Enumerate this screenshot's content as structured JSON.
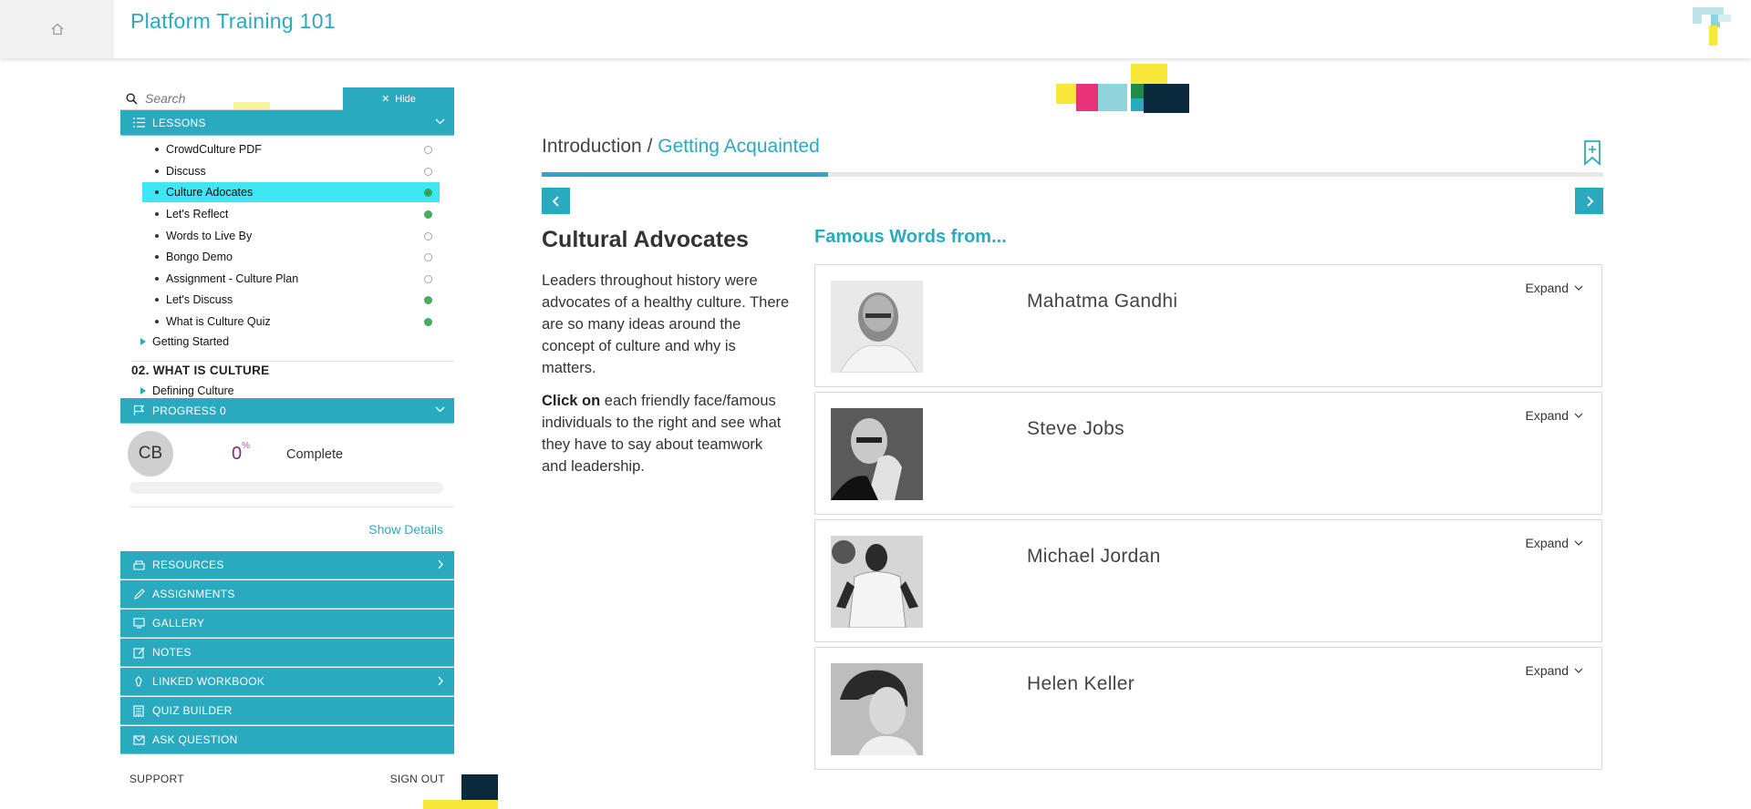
{
  "app": {
    "title": "Platform Training 101"
  },
  "sidebar": {
    "search_placeholder": "Search",
    "hide_label": "Hide",
    "lessons_header": "LESSONS",
    "lessons": [
      {
        "label": "CrowdCulture PDF",
        "status": "empty"
      },
      {
        "label": "Discuss",
        "status": "empty"
      },
      {
        "label": "Culture Adocates",
        "status": "active"
      },
      {
        "label": "Let's Reflect",
        "status": "done"
      },
      {
        "label": "Words to Live By",
        "status": "empty"
      },
      {
        "label": "Bongo Demo",
        "status": "empty"
      },
      {
        "label": "Assignment - Culture Plan",
        "status": "empty"
      },
      {
        "label": "Let's Discuss",
        "status": "done"
      },
      {
        "label": "What is Culture Quiz",
        "status": "done"
      }
    ],
    "getting_started": "Getting Started",
    "section_02": "02. WHAT IS CULTURE",
    "defining_culture": "Defining Culture",
    "progress_header": "PROGRESS 0",
    "avatar_initials": "CB",
    "progress_value": "0",
    "progress_unit": "%",
    "progress_fraction": 0,
    "complete_label": "Complete",
    "show_details": "Show Details",
    "tools": [
      {
        "label": "RESOURCES",
        "icon": "resources-icon",
        "chevron": true
      },
      {
        "label": "ASSIGNMENTS",
        "icon": "assignments-icon",
        "chevron": false
      },
      {
        "label": "GALLERY",
        "icon": "gallery-icon",
        "chevron": false
      },
      {
        "label": "NOTES",
        "icon": "notes-icon",
        "chevron": false
      },
      {
        "label": "LINKED WORKBOOK",
        "icon": "workbook-icon",
        "chevron": true
      },
      {
        "label": "QUIZ BUILDER",
        "icon": "quiz-builder-icon",
        "chevron": false
      },
      {
        "label": "ASK QUESTION",
        "icon": "ask-question-icon",
        "chevron": false
      }
    ],
    "support": "SUPPORT",
    "sign_out": "SIGN OUT"
  },
  "main": {
    "breadcrumb_parent": "Introduction",
    "breadcrumb_sep": "/",
    "breadcrumb_current": "Getting Acquainted",
    "lesson_progress_fraction": 0.27,
    "lesson_title": "Cultural Advocates",
    "intro_text": "Leaders throughout history were advocates of a healthy culture. There are so many ideas around the concept of culture and why is matters.",
    "cta_bold": "Click on",
    "cta_rest": " each friendly face/famous individuals to the right and see what they have to say about teamwork and leadership.",
    "famous_heading": "Famous Words from...",
    "expand_label": "Expand",
    "people": [
      {
        "name": "Mahatma Gandhi"
      },
      {
        "name": "Steve Jobs"
      },
      {
        "name": "Michael Jordan"
      },
      {
        "name": "Helen Keller"
      }
    ]
  },
  "colors": {
    "accent": "#2aaabf",
    "active_lesson": "#3fe6f4",
    "done": "#4cae4c",
    "deco_yellow": "#f7e83a",
    "deco_pink": "#e8327a",
    "deco_lightblue": "#8fd3dc",
    "deco_navy": "#0b2a3d",
    "deco_green": "#1f8a4a"
  }
}
